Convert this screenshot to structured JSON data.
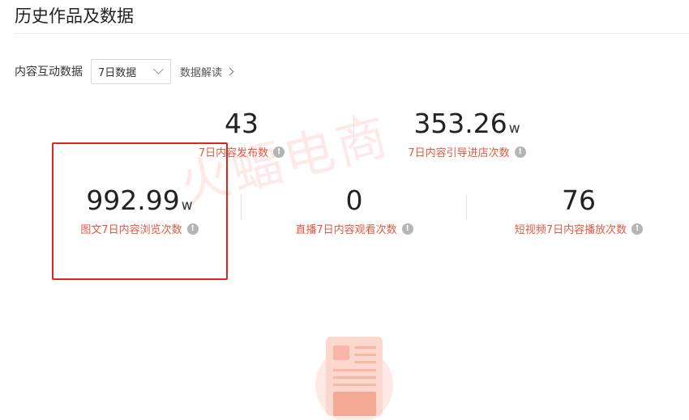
{
  "page": {
    "title": "历史作品及数据"
  },
  "filter": {
    "label": "内容互动数据",
    "selected": "7日数据",
    "interpret_link": "数据解读"
  },
  "watermark": "火蝠电商",
  "metrics": {
    "published": {
      "value": "43",
      "unit": "",
      "label": "7日内容发布数"
    },
    "store_visits": {
      "value": "353.26",
      "unit": "w",
      "label": "7日内容引导进店次数"
    },
    "article_views": {
      "value": "992.99",
      "unit": "w",
      "label": "图文7日内容浏览次数"
    },
    "live_views": {
      "value": "0",
      "unit": "",
      "label": "直播7日内容观看次数"
    },
    "video_plays": {
      "value": "76",
      "unit": "",
      "label": "短视频7日内容播放次数"
    }
  },
  "icons": {
    "info": "!",
    "info_name": "info-icon",
    "select_arrow": "chevron-down-icon",
    "link_arrow": "chevron-right-icon"
  },
  "colors": {
    "label_accent": "#e05a44",
    "highlight_border": "#e0261b",
    "illustration": "#f8d7cf"
  }
}
